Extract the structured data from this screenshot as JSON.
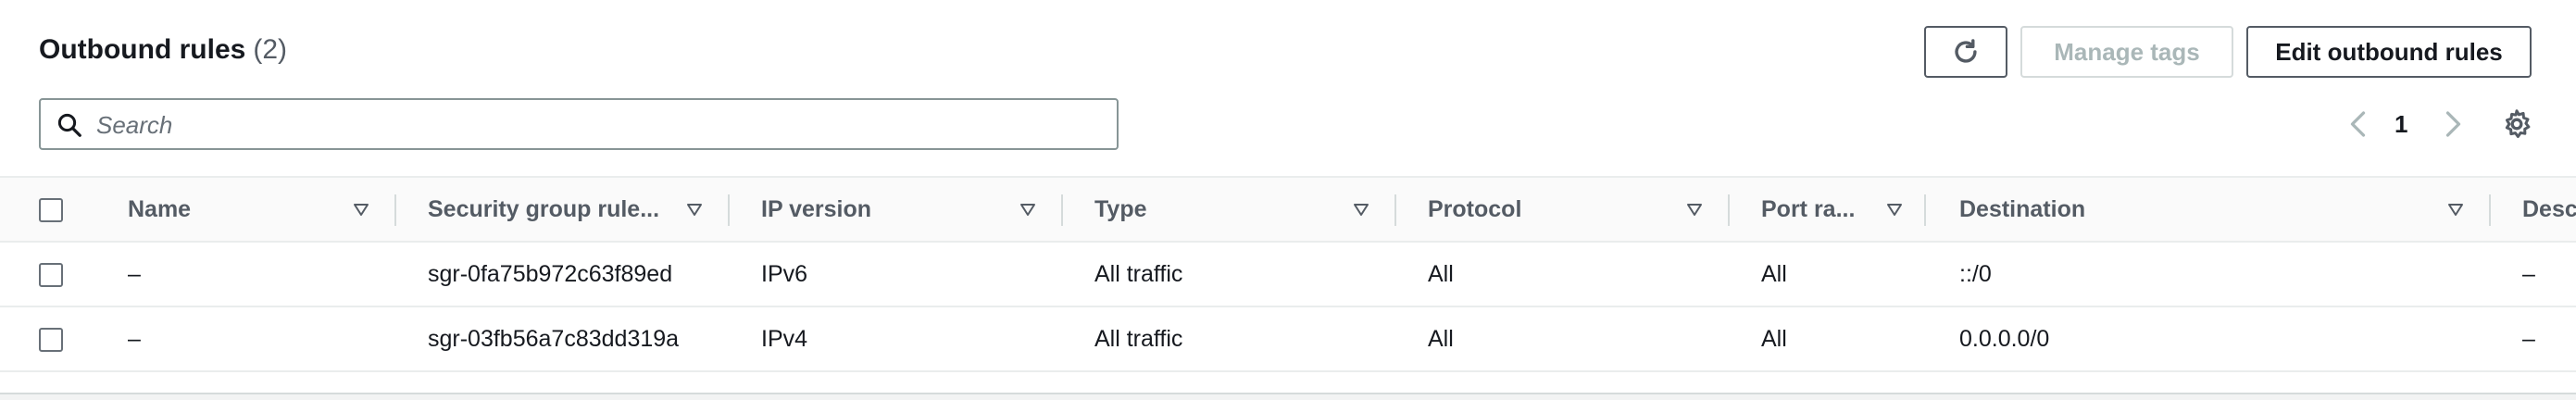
{
  "header": {
    "title": "Outbound rules",
    "count": "(2)"
  },
  "actions": {
    "refresh_icon": "refresh-icon",
    "manage_tags": "Manage tags",
    "edit_outbound_rules": "Edit outbound rules"
  },
  "search": {
    "placeholder": "Search",
    "value": ""
  },
  "pagination": {
    "current_page": "1"
  },
  "table": {
    "columns": [
      "Name",
      "Security group rule...",
      "IP version",
      "Type",
      "Protocol",
      "Port ra...",
      "Destination",
      "Desc"
    ],
    "rows": [
      {
        "name": "–",
        "security_group_rule_id": "sgr-0fa75b972c63f89ed",
        "ip_version": "IPv6",
        "type": "All traffic",
        "protocol": "All",
        "port_range": "All",
        "destination": "::/0",
        "description": "–"
      },
      {
        "name": "–",
        "security_group_rule_id": "sgr-03fb56a7c83dd319a",
        "ip_version": "IPv4",
        "type": "All traffic",
        "protocol": "All",
        "port_range": "All",
        "destination": "0.0.0.0/0",
        "description": "–"
      }
    ]
  },
  "colors": {
    "border": "#d5dbdb",
    "text": "#16191f",
    "header_text": "#545b64",
    "disabled_text": "#aab7b8"
  }
}
